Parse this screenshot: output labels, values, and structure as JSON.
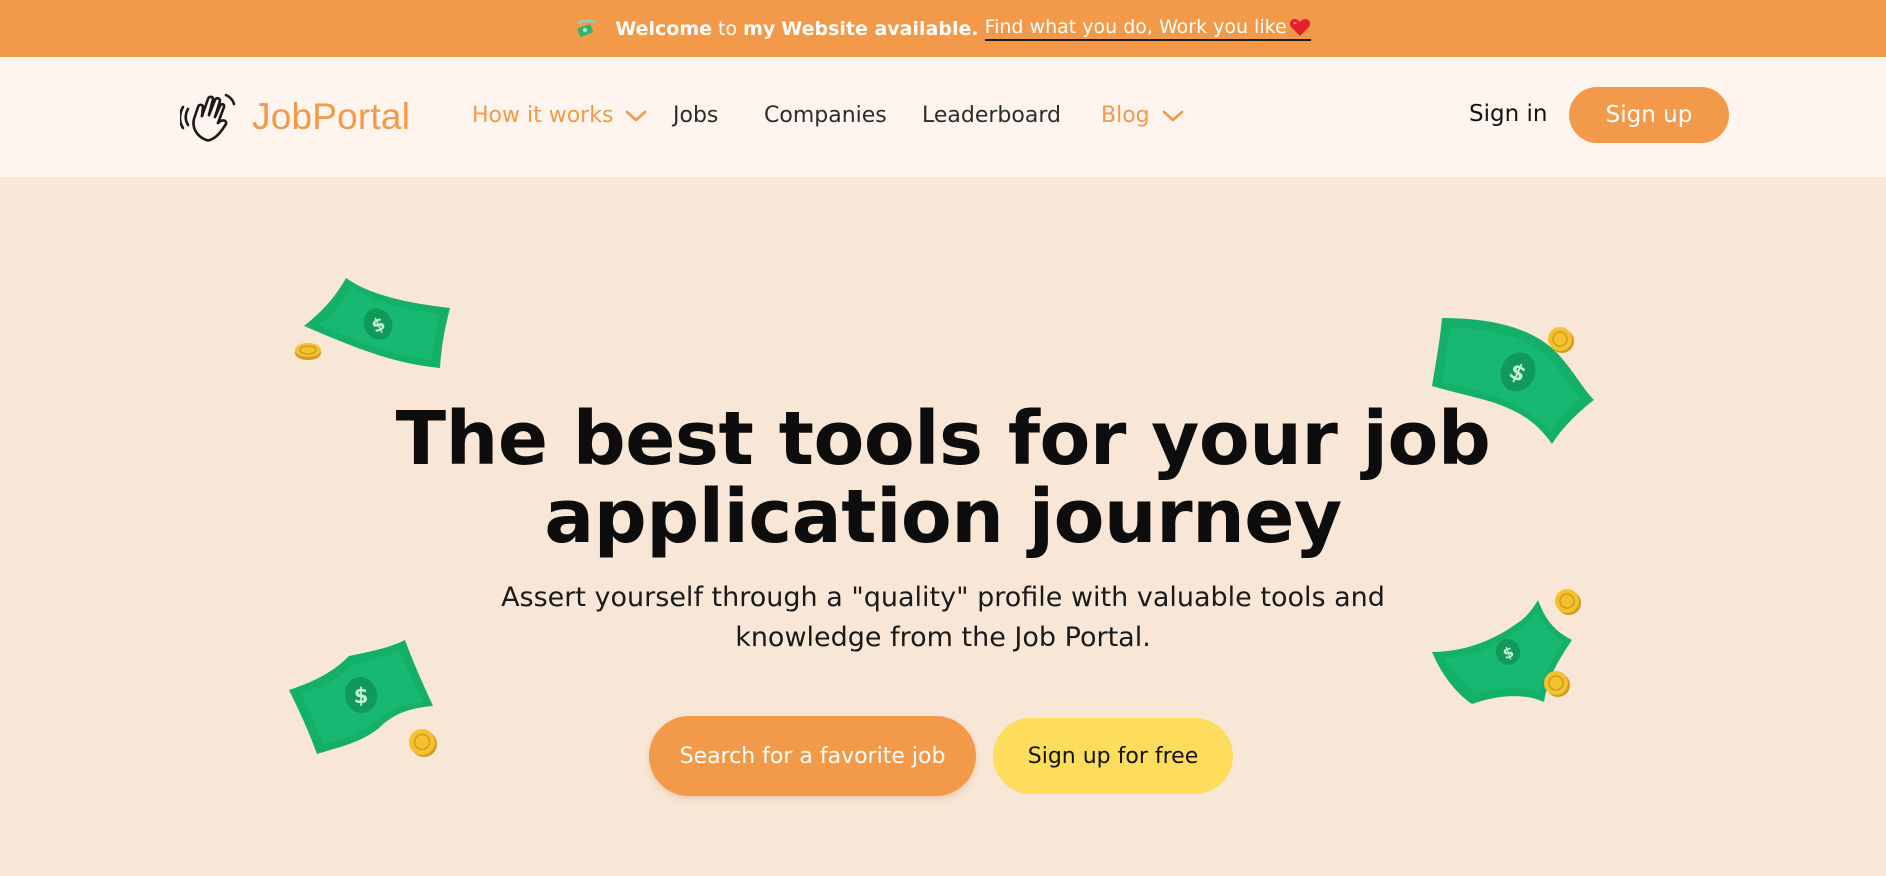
{
  "announcement": {
    "icon": "money-with-wings-icon",
    "welcome_bold": "Welcome",
    "to_text": "to",
    "my_bold": "my",
    "website_text": "Website available.",
    "link_text": "Find what you do, Work you like",
    "heart_icon": "heart-icon",
    "bg_color": "#f39a4a"
  },
  "brand": {
    "icon": "waving-hand-icon",
    "name": "JobPortal",
    "color": "#f39a4a"
  },
  "nav": {
    "how_it_works": "How it works",
    "jobs": "Jobs",
    "companies": "Companies",
    "leaderboard": "Leaderboard",
    "blog": "Blog"
  },
  "auth": {
    "sign_in": "Sign in",
    "sign_up": "Sign up"
  },
  "hero": {
    "title_line1": "The best tools for your job",
    "title_line2": "application journey",
    "subtitle_line1": "Assert yourself through a \"quality\" profile with valuable tools and",
    "subtitle_line2": "knowledge from the Job Portal.",
    "cta_primary": "Search for a favorite job",
    "cta_secondary": "Sign up for free"
  },
  "colors": {
    "accent": "#f39a4a",
    "hero_bg": "#f8e6d7",
    "nav_bg": "#fff5ee",
    "cta_yellow": "#fedd5c",
    "bill_green": "#14b06a"
  }
}
